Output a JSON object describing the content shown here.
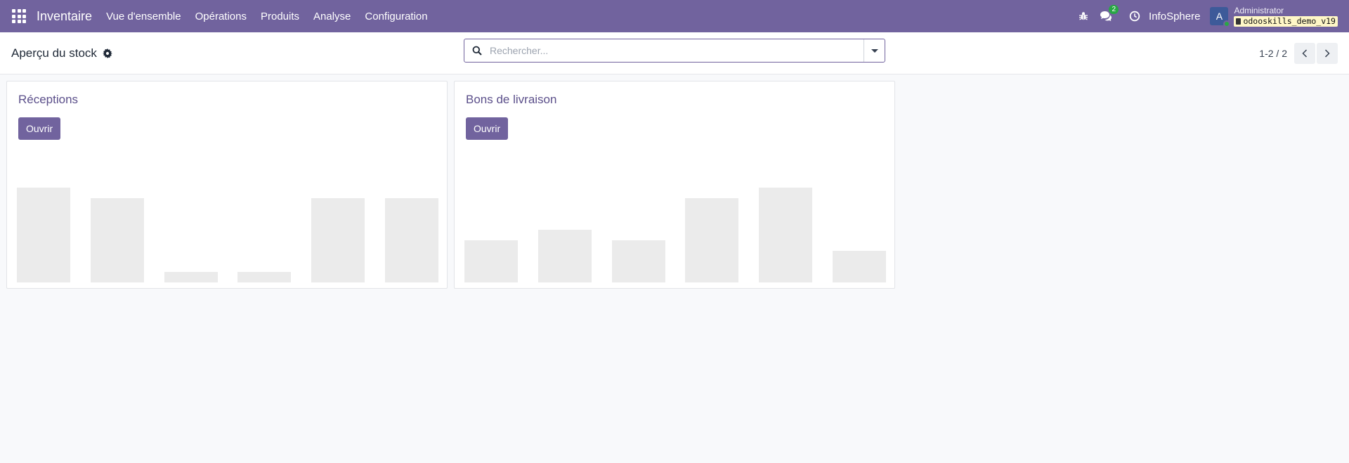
{
  "navbar": {
    "brand": "Inventaire",
    "menu": [
      "Vue d'ensemble",
      "Opérations",
      "Produits",
      "Analyse",
      "Configuration"
    ],
    "messages_badge": "2",
    "company": "InfoSphere",
    "user_initial": "A",
    "user_name": "Administrator",
    "database": "odooskills_demo_v19",
    "accent_color": "#71639e"
  },
  "control_panel": {
    "title": "Aperçu du stock",
    "search_placeholder": "Rechercher...",
    "pager_value": "1-2 / 2"
  },
  "cards": [
    {
      "title": "Réceptions",
      "button_label": "Ouvrir",
      "bar_levels": [
        0.9,
        0.8,
        0.1,
        0.1,
        0.8,
        0.8
      ]
    },
    {
      "title": "Bons de livraison",
      "button_label": "Ouvrir",
      "bar_levels": [
        0.4,
        0.5,
        0.4,
        0.8,
        0.9,
        0.3
      ]
    }
  ]
}
